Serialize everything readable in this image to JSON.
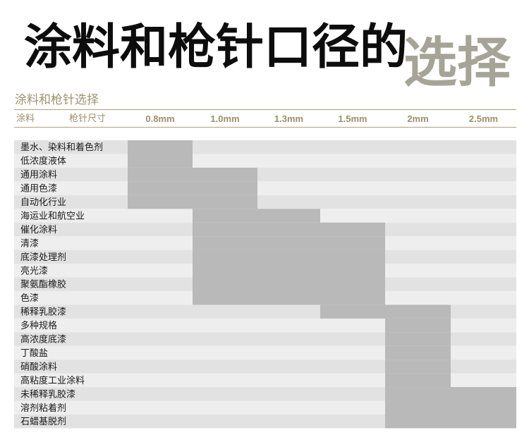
{
  "title": "涂料和枪针口径的",
  "title_accent": "选择",
  "subtitle": "涂料和枪针选择",
  "colors": {
    "row_light": "#e2e2e2",
    "row_lighter": "#eeeeee",
    "range_fill": "#b9b9b9",
    "accent_gray": "#a5a496",
    "gold": "#a1926f"
  },
  "chart_data": {
    "type": "table",
    "column_headers": {
      "coating": "涂料",
      "needle_size": "枪针尺寸"
    },
    "needle_sizes": [
      "0.8mm",
      "1.0mm",
      "1.3mm",
      "1.5mm",
      "2mm",
      "2.5mm"
    ],
    "rows": [
      {
        "coating": "墨水、染料和着色剂",
        "range": [
          "0.8mm",
          "0.8mm"
        ]
      },
      {
        "coating": "低浓度液体",
        "range": [
          "0.8mm",
          "0.8mm"
        ]
      },
      {
        "coating": "通用涂料",
        "range": [
          "0.8mm",
          "1.0mm"
        ]
      },
      {
        "coating": "通用色漆",
        "range": [
          "0.8mm",
          "1.0mm"
        ]
      },
      {
        "coating": "自动化行业",
        "range": [
          "0.8mm",
          "1.0mm"
        ]
      },
      {
        "coating": "海运业和航空业",
        "range": [
          "1.0mm",
          "1.3mm"
        ]
      },
      {
        "coating": "催化涂料",
        "range": [
          "1.0mm",
          "1.5mm"
        ]
      },
      {
        "coating": "清漆",
        "range": [
          "1.0mm",
          "1.5mm"
        ]
      },
      {
        "coating": "底漆处理剂",
        "range": [
          "1.0mm",
          "1.5mm"
        ]
      },
      {
        "coating": "亮光漆",
        "range": [
          "1.0mm",
          "1.5mm"
        ]
      },
      {
        "coating": "聚氨酯橡胶",
        "range": [
          "1.0mm",
          "1.5mm"
        ]
      },
      {
        "coating": "色漆",
        "range": [
          "1.0mm",
          "1.5mm"
        ]
      },
      {
        "coating": "稀释乳胶漆",
        "range": [
          "1.5mm",
          "2mm"
        ]
      },
      {
        "coating": "多种规格",
        "range": [
          "2mm",
          "2mm"
        ]
      },
      {
        "coating": "高浓度底漆",
        "range": [
          "2mm",
          "2mm"
        ]
      },
      {
        "coating": "丁酸盐",
        "range": [
          "2mm",
          "2mm"
        ]
      },
      {
        "coating": "硝酸涂料",
        "range": [
          "2mm",
          "2mm"
        ]
      },
      {
        "coating": "高粘度工业涂料",
        "range": [
          "2mm",
          "2mm"
        ]
      },
      {
        "coating": "未稀释乳胶漆",
        "range": [
          "2mm",
          "2.5mm"
        ]
      },
      {
        "coating": "溶剂粘着剂",
        "range": [
          "2mm",
          "2.5mm"
        ]
      },
      {
        "coating": "石蜡基脱剂",
        "range": [
          "2mm",
          "2.5mm"
        ]
      }
    ]
  }
}
